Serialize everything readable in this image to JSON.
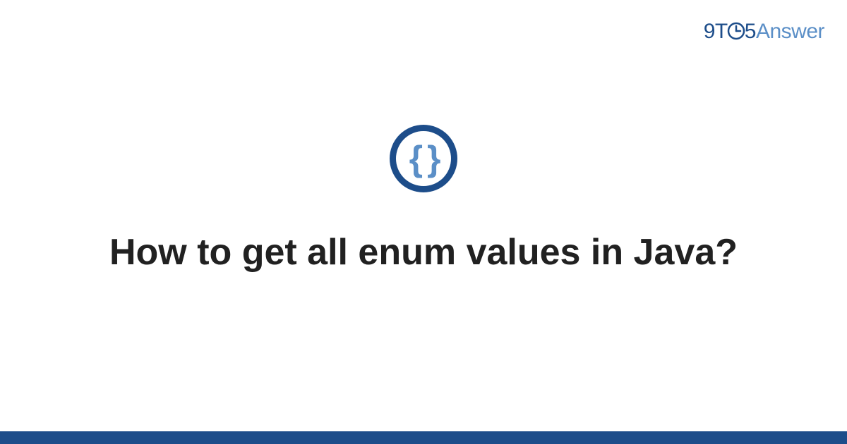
{
  "logo": {
    "part1": "9T",
    "clock": "O",
    "part2": "5",
    "part3": "Answer"
  },
  "icon": {
    "name": "code-braces-icon",
    "glyph": "{ }"
  },
  "title": "How to get all enum values in Java?",
  "colors": {
    "primary": "#1d4d8a",
    "secondary": "#5b8fc7",
    "text": "#212121"
  }
}
